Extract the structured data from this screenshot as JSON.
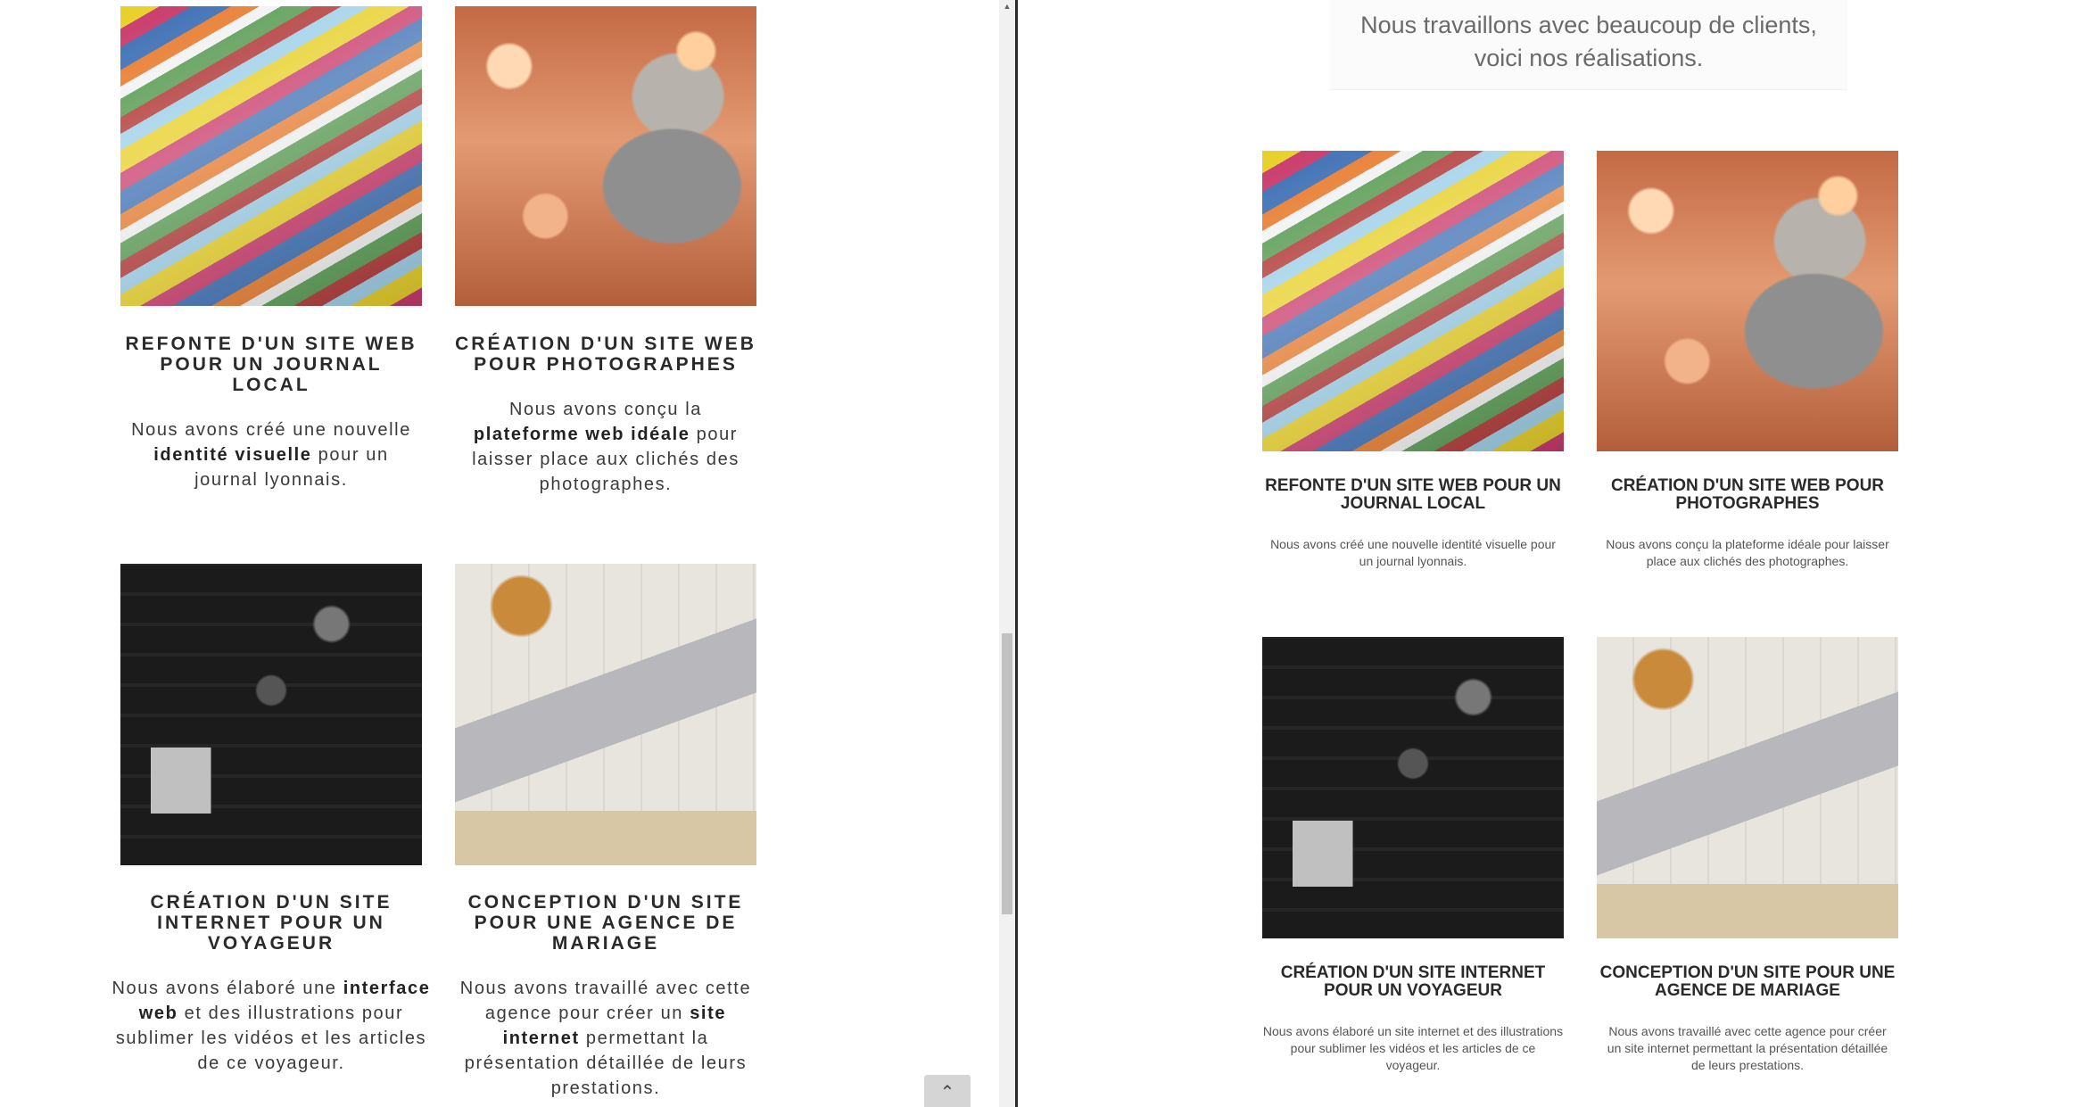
{
  "left": {
    "cards": [
      {
        "image": "magazines-photo",
        "title": "REFONTE D'UN SITE WEB POUR UN JOURNAL LOCAL",
        "desc_parts": [
          "Nous avons créé une nouvelle ",
          "identité visuelle",
          " pour un journal lyonnais."
        ]
      },
      {
        "image": "photographer-photo",
        "title": "CRÉATION D'UN SITE WEB POUR PHOTOGRAPHES",
        "desc_parts": [
          "Nous avons conçu la ",
          "plateforme web idéale",
          " pour laisser place aux clichés des photographes."
        ]
      },
      {
        "image": "camera-gear-photo",
        "title": "CRÉATION D'UN SITE INTERNET POUR UN VOYAGEUR",
        "desc_parts": [
          "Nous avons élaboré une ",
          "interface web",
          " et des illustrations pour sublimer les vidéos et les articles de ce voyageur."
        ]
      },
      {
        "image": "laptop-desk-photo",
        "title": "CONCEPTION D'UN SITE POUR UNE AGENCE DE MARIAGE",
        "desc_parts": [
          "Nous avons travaillé avec cette agence pour créer un ",
          "site internet",
          " permettant la présentation détaillée de leurs prestations."
        ]
      }
    ],
    "back_to_top_icon": "chevron-up-icon"
  },
  "right": {
    "intro_line1": "Nous travaillons avec beaucoup de clients,",
    "intro_line2": "voici nos réalisations.",
    "cards": [
      {
        "image": "magazines-photo",
        "title": "REFONTE D'UN SITE WEB POUR UN JOURNAL LOCAL",
        "desc": "Nous avons créé une nouvelle identité visuelle pour un journal lyonnais."
      },
      {
        "image": "photographer-photo",
        "title": "CRÉATION D'UN SITE WEB POUR PHOTOGRAPHES",
        "desc": "Nous avons conçu la plateforme idéale pour laisser place aux clichés des photographes."
      },
      {
        "image": "camera-gear-photo",
        "title": "CRÉATION D'UN SITE INTERNET POUR UN VOYAGEUR",
        "desc": "Nous avons élaboré un site internet et des illustrations pour sublimer les vidéos et les articles de ce voyageur."
      },
      {
        "image": "laptop-desk-photo",
        "title": "CONCEPTION D'UN SITE POUR UNE AGENCE DE MARIAGE",
        "desc": "Nous avons travaillé avec cette agence pour créer un site internet permettant la présentation détaillée de leurs prestations."
      }
    ]
  },
  "scrollbar": {
    "up_arrow_icon": "scroll-up-arrow-icon"
  }
}
